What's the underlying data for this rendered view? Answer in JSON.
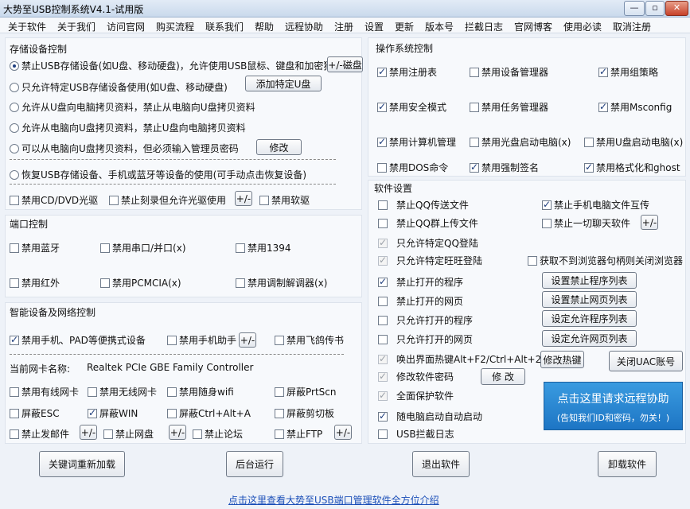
{
  "window": {
    "title": "大势至USB控制系统V4.1-试用版",
    "min": "—",
    "max": "▫",
    "close": "✕"
  },
  "menu": [
    "关于软件",
    "关于我们",
    "访问官网",
    "购买流程",
    "联系我们",
    "帮助",
    "远程协助",
    "注册",
    "设置",
    "更新",
    "版本号",
    "拦截日志",
    "官网博客",
    "使用必读",
    "取消注册"
  ],
  "storage": {
    "title": "存储设备控制",
    "r1": "禁止USB存储设备(如U盘、移动硬盘)，允许使用USB鼠标、键盘和加密狗",
    "r1_btn": "+/-磁盘",
    "r2": "只允许特定USB存储设备使用(如U盘、移动硬盘)",
    "r2_btn": "添加特定U盘",
    "r3": "允许从U盘向电脑拷贝资料，禁止从电脑向U盘拷贝资料",
    "r4": "允许从电脑向U盘拷贝资料，禁止U盘向电脑拷贝资料",
    "r5": "可以从电脑向U盘拷贝资料，但必须输入管理员密码",
    "r5_btn": "修改",
    "r6": "恢复USB存储设备、手机或蓝牙等设备的使用(可手动点击恢复设备)",
    "c1": "禁用CD/DVD光驱",
    "c2": "禁止刻录但允许光驱使用",
    "c2_btn": "+/-",
    "c3": "禁用软驱"
  },
  "port": {
    "title": "端口控制",
    "c1": "禁用蓝牙",
    "c2": "禁用串口/并口(x)",
    "c3": "禁用1394",
    "c4": "禁用红外",
    "c5": "禁用PCMCIA(x)",
    "c6": "禁用调制解调器(x)"
  },
  "smart": {
    "title": "智能设备及网络控制",
    "c1": "禁用手机、PAD等便携式设备",
    "c2": "禁用手机助手",
    "c2_btn": "+/-",
    "c3": "禁用飞鸽传书",
    "nic_label": "当前网卡名称:",
    "nic_name": "Realtek PCIe GBE Family Controller",
    "n1": "禁用有线网卡",
    "n2": "禁用无线网卡",
    "n3": "禁用随身wifi",
    "n4": "屏蔽PrtScn",
    "n5": "屏蔽ESC",
    "n6": "屏蔽WIN",
    "n7": "屏蔽Ctrl+Alt+A",
    "n8": "屏蔽剪切板",
    "n9": "禁止发邮件",
    "n9_btn": "+/-",
    "n10": "禁止网盘",
    "n10_btn": "+/-",
    "n11": "禁止论坛",
    "n12": "禁止FTP",
    "n12_btn": "+/-"
  },
  "os": {
    "title": "操作系统控制",
    "c1": "禁用注册表",
    "c2": "禁用设备管理器",
    "c3": "禁用组策略",
    "c4": "禁用安全模式",
    "c5": "禁用任务管理器",
    "c6": "禁用Msconfig",
    "c7": "禁用计算机管理",
    "c8": "禁用光盘启动电脑(x)",
    "c9": "禁用U盘启动电脑(x)",
    "c10": "禁用DOS命令",
    "c11": "禁用强制签名",
    "c12": "禁用格式化和ghost"
  },
  "soft": {
    "title": "软件设置",
    "s1": "禁止QQ传送文件",
    "s2": "禁止手机电脑文件互传",
    "s3": "禁止QQ群上传文件",
    "s4": "禁止一切聊天软件",
    "s4_btn": "+/-",
    "s5": "只允许特定QQ登陆",
    "s6": "只允许特定旺旺登陆",
    "s7": "获取不到浏览器句柄则关闭浏览器",
    "s8": "禁止打开的程序",
    "s8_btn": "设置禁止程序列表",
    "s9": "禁止打开的网页",
    "s9_btn": "设置禁止网页列表",
    "s10": "只允许打开的程序",
    "s10_btn": "设定允许程序列表",
    "s11": "只允许打开的网页",
    "s11_btn": "设定允许网页列表",
    "s12": "唤出界面热键Alt+F2/Ctrl+Alt+2",
    "s12_btn": "修改热键",
    "uac_btn": "关闭UAC账号",
    "s13": "修改软件密码",
    "s13_btn": "修 改",
    "s14": "全面保护软件",
    "s15": "随电脑启动自动启动",
    "s16": "USB拦截日志"
  },
  "remote": {
    "line1": "点击这里请求远程协助",
    "line2": "(告知我们ID和密码，勿关！)"
  },
  "bottom": {
    "b1": "关键词重新加载",
    "b2": "后台运行",
    "b3": "退出软件",
    "b4": "卸载软件"
  },
  "footer": {
    "link": "点击这里查看大势至USB端口管理软件全方位介绍"
  },
  "colors": {
    "accent": "#2a8ad8",
    "link": "#1b4fb8"
  }
}
